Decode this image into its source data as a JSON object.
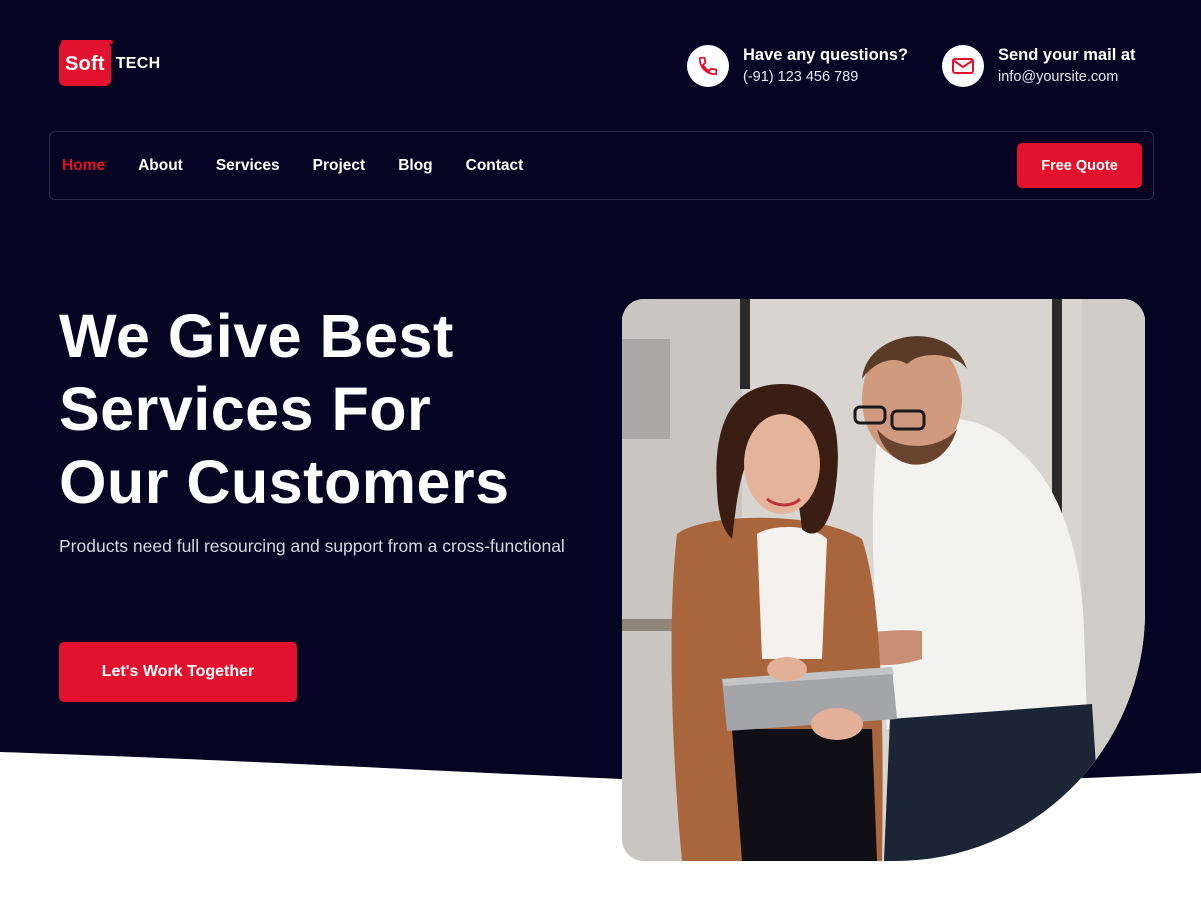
{
  "brand": {
    "logo_main": "Soft",
    "logo_suffix": "TECH"
  },
  "contact": {
    "phone_title": "Have any questions?",
    "phone_value": "(-91) 123 456 789",
    "mail_title": "Send your mail at",
    "mail_value": "info@yoursite.com"
  },
  "nav": {
    "items": [
      {
        "label": "Home",
        "active": true
      },
      {
        "label": "About"
      },
      {
        "label": "Services"
      },
      {
        "label": "Project"
      },
      {
        "label": "Blog"
      },
      {
        "label": "Contact"
      }
    ],
    "cta_label": "Free Quote"
  },
  "hero": {
    "title_line1": "We Give Best",
    "title_line2": "Services For",
    "title_line3": "Our Customers",
    "subtitle": "Products need full resourcing and support from a cross-functional",
    "cta_label": "Let's Work Together"
  },
  "colors": {
    "background": "#050423",
    "accent": "#e2112d",
    "white": "#ffffff"
  },
  "icons": [
    "phone-icon",
    "mail-icon"
  ]
}
